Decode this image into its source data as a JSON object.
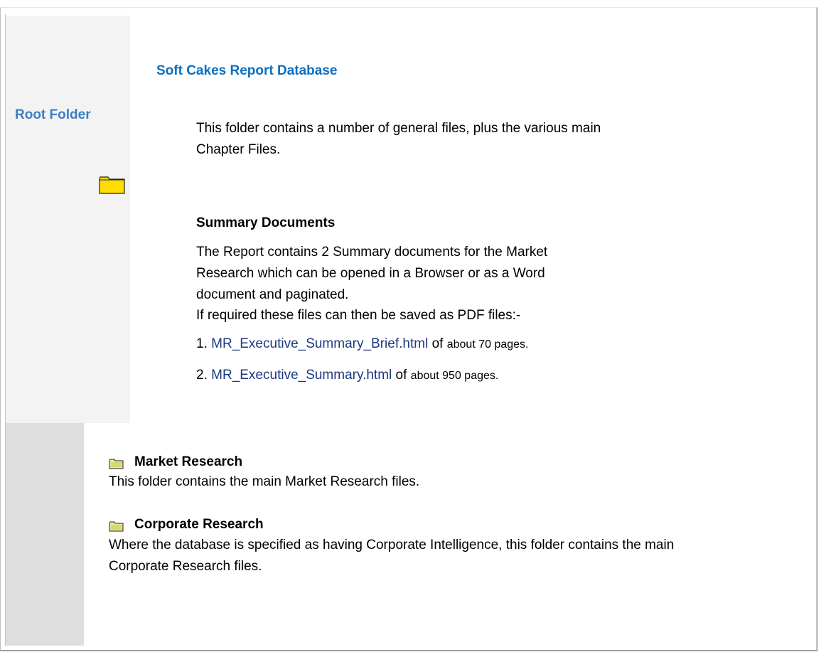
{
  "sidebar": {
    "title": "Root Folder"
  },
  "main": {
    "title": "Soft Cakes Report Database",
    "intro": "This folder contains a number of general files, plus the various main Chapter Files.",
    "summary_heading": "Summary Documents",
    "summary_body": "The Report contains 2 Summary documents for the Market Research which can be opened in a Browser or as a Word document and paginated.",
    "pdf_note": "If required these files can then be saved as PDF files:-",
    "items": [
      {
        "number": "1.",
        "link": "MR_Executive_Summary_Brief.html",
        "of": "of",
        "pages": "about 70 pages."
      },
      {
        "number": "2.",
        "link": "MR_Executive_Summary.html",
        "of": "of",
        "pages": "about 950 pages."
      }
    ]
  },
  "folders": [
    {
      "title": "Market Research",
      "description": "This folder contains the main Market Research files."
    },
    {
      "title": "Corporate Research",
      "description": "Where the database is specified as having Corporate Intelligence, this folder contains the main Corporate Research files."
    }
  ],
  "colors": {
    "root_title": "#3b7fc2",
    "db_title": "#0a6fc2",
    "link": "#1a3a80",
    "folder_yellow": "#ffdd00"
  },
  "icons": [
    "folder-icon"
  ]
}
